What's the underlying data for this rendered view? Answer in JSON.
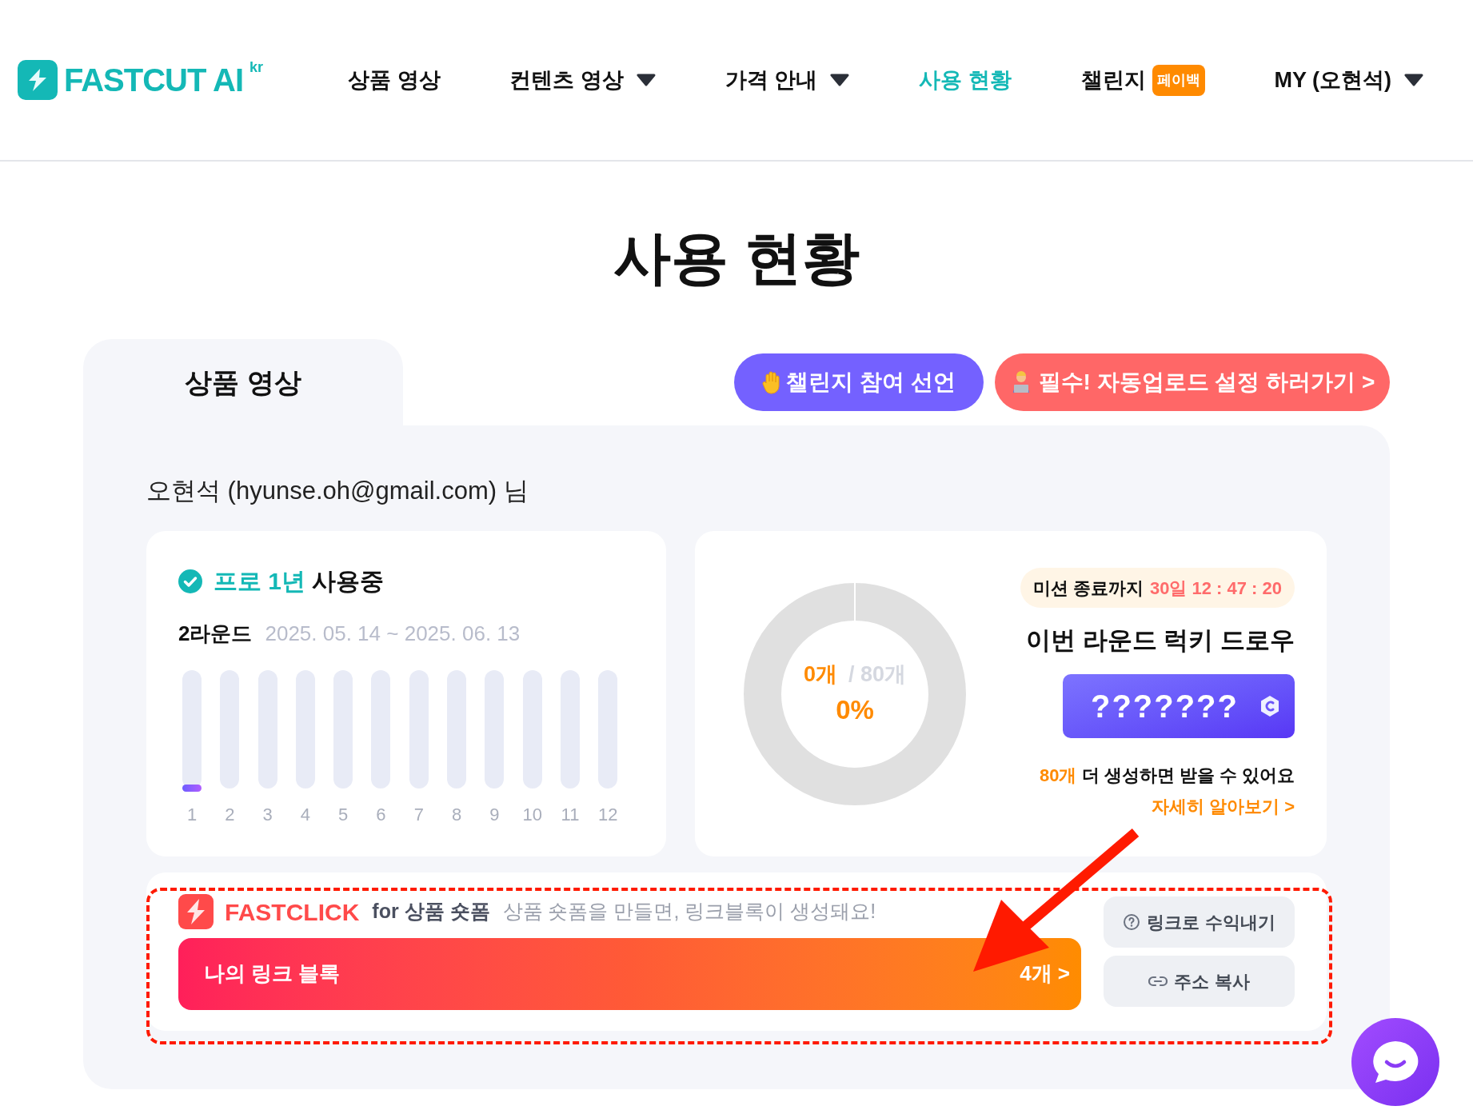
{
  "header": {
    "logo": {
      "name": "FASTCUT AI",
      "superscript": "kr"
    },
    "nav": [
      {
        "label": "상품 영상",
        "selected": false,
        "dropdown": false
      },
      {
        "label": "컨텐츠 영상",
        "selected": false,
        "dropdown": true
      },
      {
        "label": "가격 안내",
        "selected": false,
        "dropdown": true
      },
      {
        "label": "사용 현황",
        "selected": true,
        "dropdown": false
      },
      {
        "label": "챌린지",
        "selected": false,
        "dropdown": false,
        "badge": "페이백"
      },
      {
        "label": "MY (오현석)",
        "selected": false,
        "dropdown": true
      }
    ]
  },
  "page_title": "사용 현황",
  "tabs": [
    {
      "label": "상품 영상",
      "selected": true
    }
  ],
  "actions": [
    {
      "label": "챌린지 참여 선언",
      "kind": "challenge"
    },
    {
      "label": "필수! 자동업로드 설정 하러가기 >",
      "kind": "upload"
    }
  ],
  "user_line": "오현석 (hyunse.oh@gmail.com) 님",
  "plan": {
    "name": "프로 1년",
    "status": "사용중",
    "round": "2라운드",
    "period": "2025. 05. 14 ~ 2025. 06. 13",
    "rounds": [
      {
        "label": "1",
        "active": true
      },
      {
        "label": "2",
        "active": false
      },
      {
        "label": "3",
        "active": false
      },
      {
        "label": "4",
        "active": false
      },
      {
        "label": "5",
        "active": false
      },
      {
        "label": "6",
        "active": false
      },
      {
        "label": "7",
        "active": false
      },
      {
        "label": "8",
        "active": false
      },
      {
        "label": "9",
        "active": false
      },
      {
        "label": "10",
        "active": false
      },
      {
        "label": "11",
        "active": false
      },
      {
        "label": "12",
        "active": false
      }
    ]
  },
  "mission": {
    "countdown_label": "미션 종료까지",
    "countdown": "30일 12 : 47 : 20",
    "count": "0개",
    "total": "/ 80개",
    "percent": "0%",
    "title": "이번 라운드 럭키 드로우",
    "prize": "???????",
    "remaining": "80개",
    "remaining_text": "더 생성하면 받을 수 있어요",
    "link": "자세히 알아보기 >"
  },
  "fastclick": {
    "brand": "FASTCLICK",
    "subtitle": "for 상품 숏폼",
    "description": "상품 숏폼을 만들면, 링크블록이 생성돼요!",
    "bar_label": "나의 링크 블록",
    "bar_count": "4개 >",
    "buttons": [
      {
        "label": "링크로 수익내기",
        "kind": "help"
      },
      {
        "label": "주소 복사",
        "kind": "link"
      }
    ]
  }
}
